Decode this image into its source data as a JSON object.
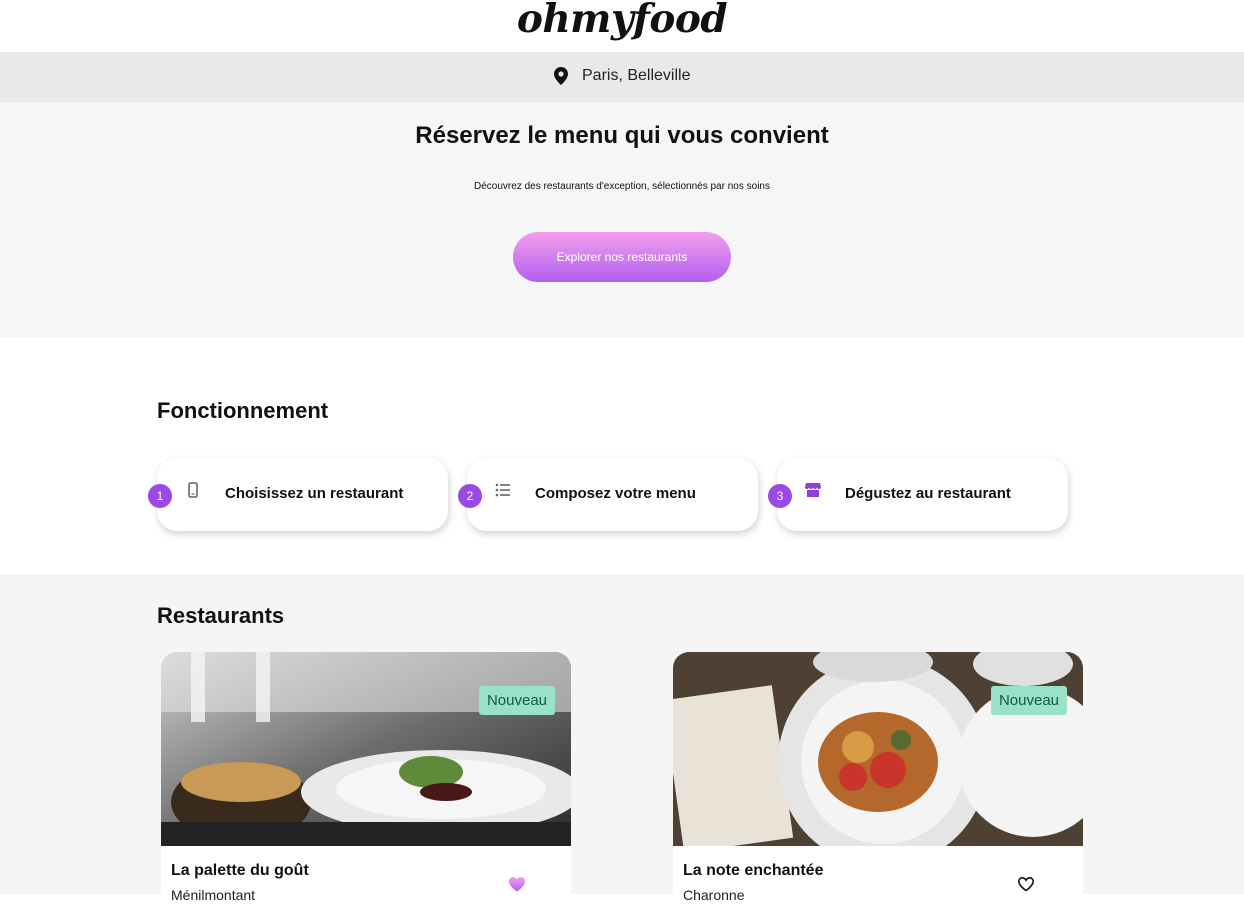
{
  "header": {
    "logo": "ohmyfood"
  },
  "location": {
    "icon": "map-pin-icon",
    "text": "Paris, Belleville"
  },
  "hero": {
    "title": "Réservez le menu qui vous convient",
    "subtitle": "Découvrez des restaurants d'exception, sélectionnés par nos soins",
    "cta_label": "Explorer nos restaurants"
  },
  "how": {
    "title": "Fonctionnement",
    "steps": [
      {
        "number": "1",
        "icon": "smartphone-icon",
        "label": "Choisissez un restaurant"
      },
      {
        "number": "2",
        "icon": "list-icon",
        "label": "Composez votre menu"
      },
      {
        "number": "3",
        "icon": "store-icon",
        "label": "Dégustez au restaurant"
      }
    ]
  },
  "restaurants": {
    "title": "Restaurants",
    "cards": [
      {
        "badge": "Nouveau",
        "name": "La palette du goût",
        "area": "Ménilmontant",
        "favorited": true
      },
      {
        "badge": "Nouveau",
        "name": "La note enchantée",
        "area": "Charonne",
        "favorited": false
      }
    ]
  },
  "colors": {
    "accent_purple": "#9a48e6",
    "gradient_start": "#f39fec",
    "gradient_end": "#b15ff2",
    "badge_bg": "#99e1c7",
    "badge_text": "#0f5c45",
    "heart_filled": "#d77be6"
  }
}
